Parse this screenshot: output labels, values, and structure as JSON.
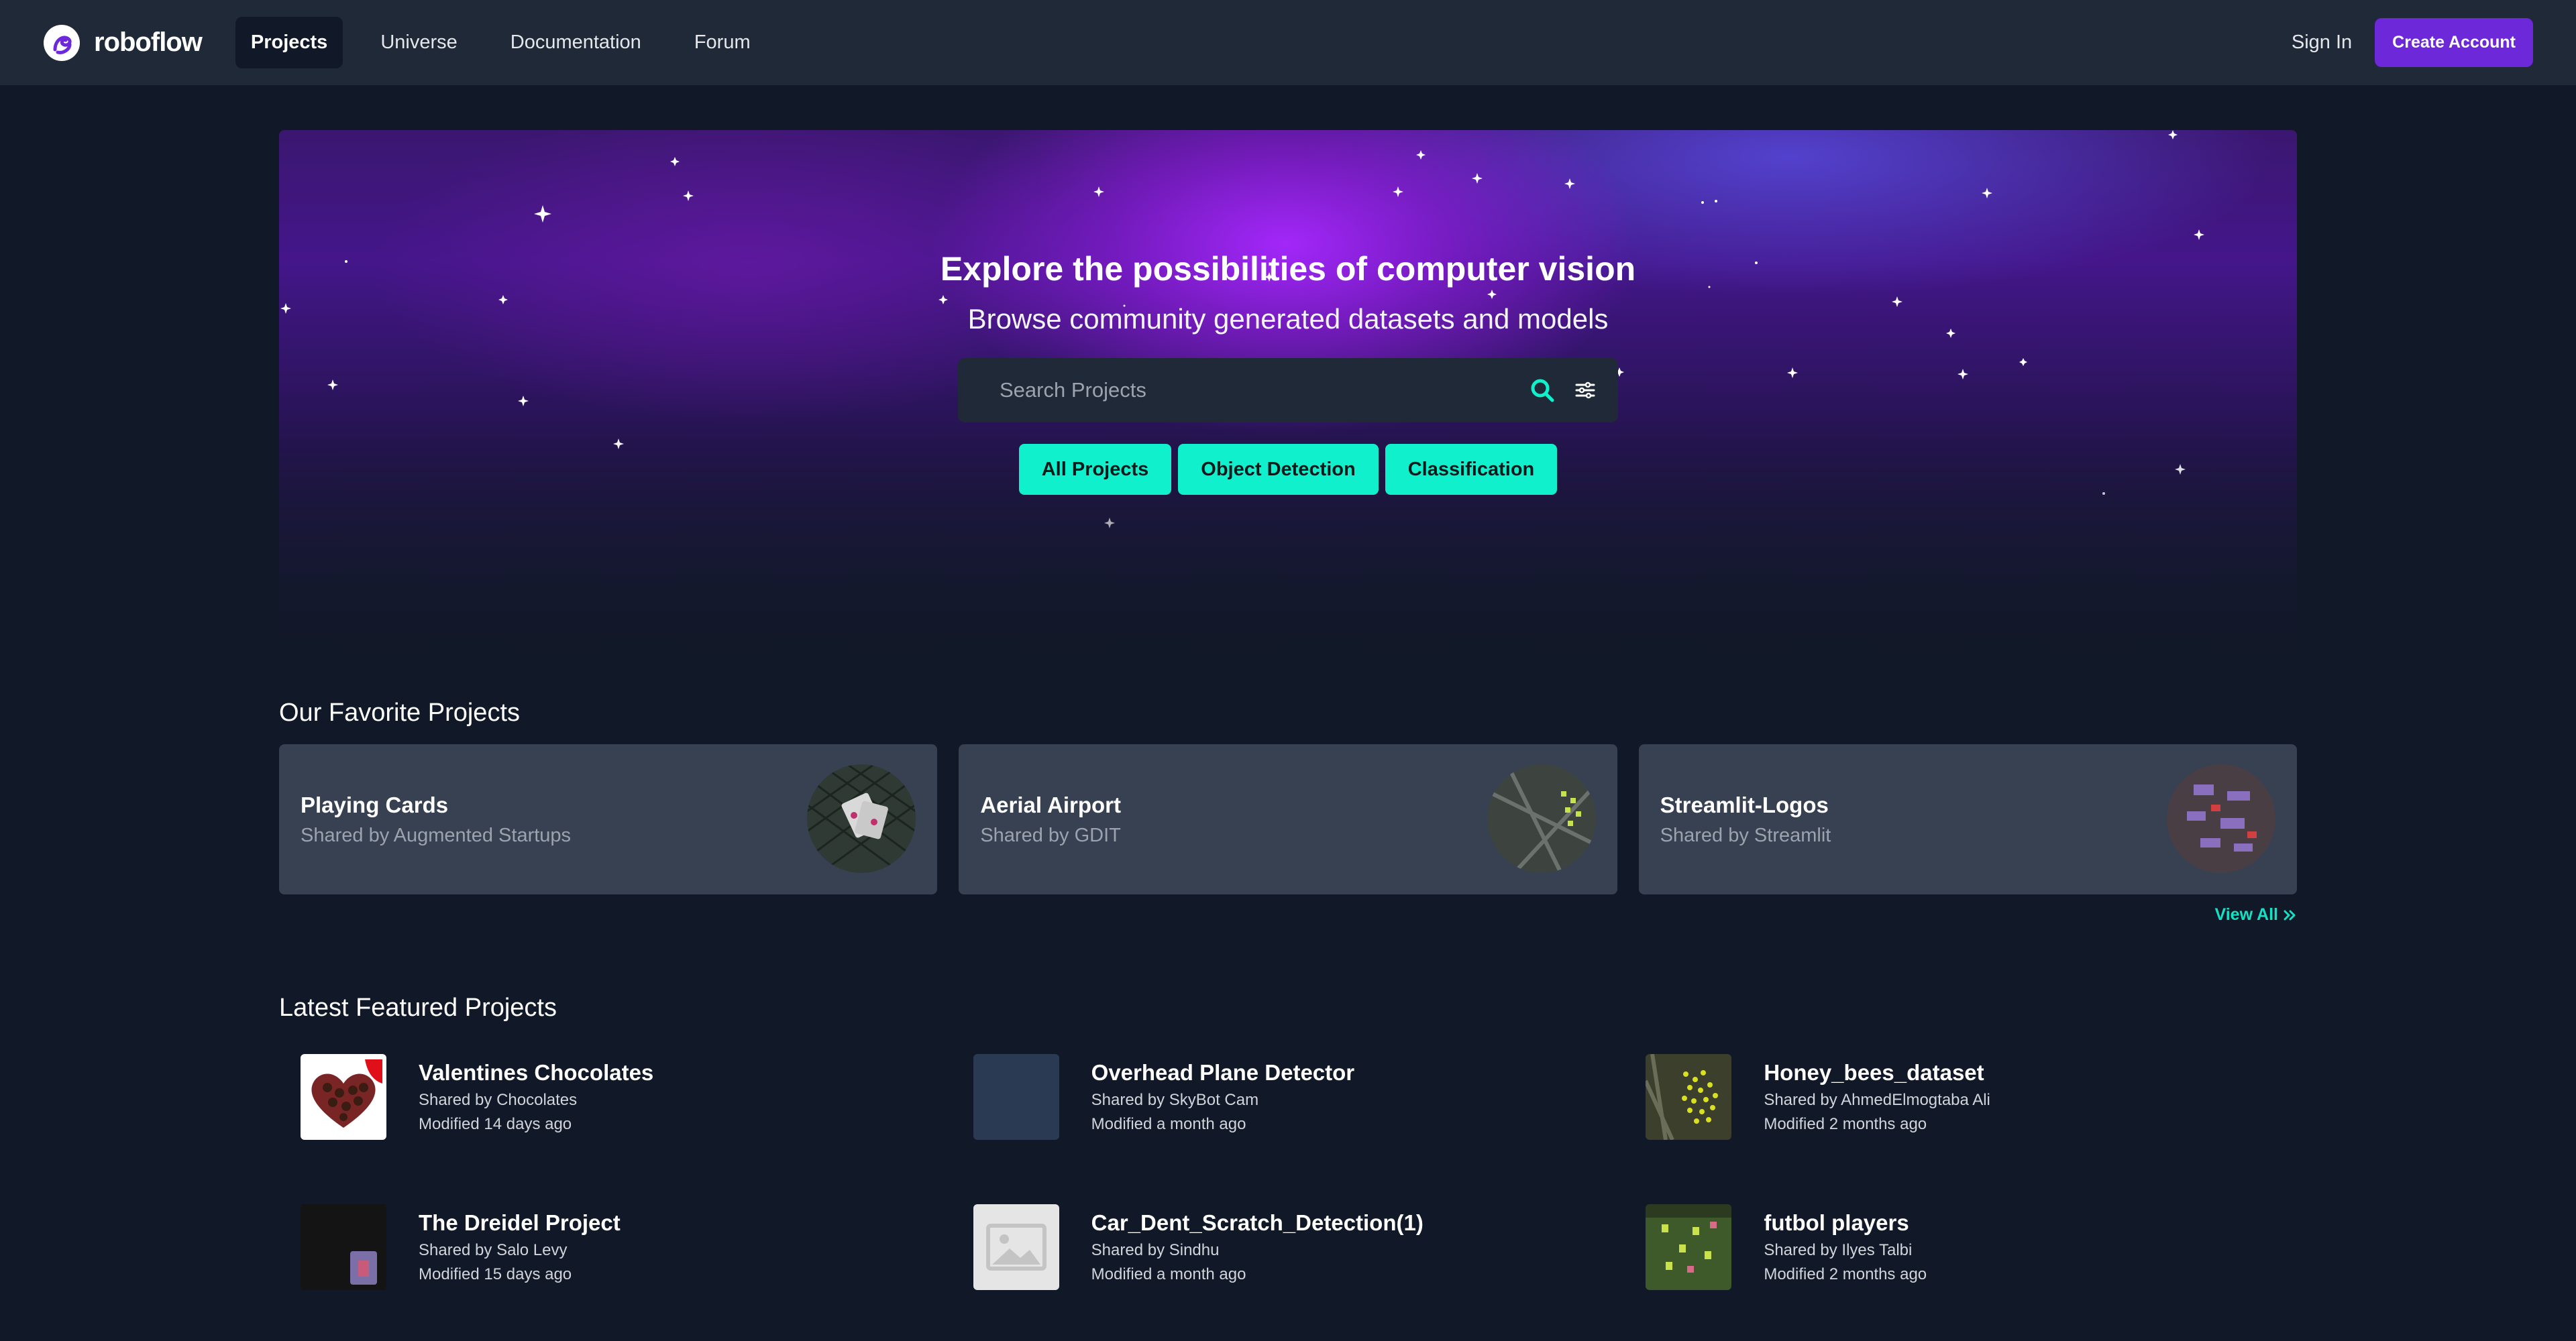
{
  "nav": {
    "logo_text": "roboflow",
    "items": [
      {
        "label": "Projects",
        "active": true
      },
      {
        "label": "Universe",
        "active": false
      },
      {
        "label": "Documentation",
        "active": false
      },
      {
        "label": "Forum",
        "active": false
      }
    ],
    "sign_in": "Sign In",
    "create_account": "Create Account"
  },
  "hero": {
    "title": "Explore the possibilities of computer vision",
    "subtitle": "Browse community generated datasets and models",
    "search_placeholder": "Search Projects",
    "chips": [
      "All Projects",
      "Object Detection",
      "Classification"
    ]
  },
  "favorites": {
    "title": "Our Favorite Projects",
    "cards": [
      {
        "name": "Playing Cards",
        "shared_by": "Shared by Augmented Startups",
        "thumb": "playing-cards-thumb"
      },
      {
        "name": "Aerial Airport",
        "shared_by": "Shared by GDIT",
        "thumb": "aerial-airport-thumb"
      },
      {
        "name": "Streamlit-Logos",
        "shared_by": "Shared by Streamlit",
        "thumb": "streamlit-logos-thumb"
      }
    ],
    "view_all": "View All"
  },
  "latest": {
    "title": "Latest Featured Projects",
    "items": [
      {
        "name": "Valentines Chocolates",
        "shared_by": "Shared by Chocolates",
        "modified": "Modified 14 days ago",
        "thumb": "chocolates-thumb"
      },
      {
        "name": "Overhead Plane Detector",
        "shared_by": "Shared by SkyBot Cam",
        "modified": "Modified a month ago",
        "thumb": "plane-thumb"
      },
      {
        "name": "Honey_bees_dataset",
        "shared_by": "Shared by AhmedElmogtaba Ali",
        "modified": "Modified 2 months ago",
        "thumb": "bees-thumb"
      },
      {
        "name": "The Dreidel Project",
        "shared_by": "Shared by Salo Levy",
        "modified": "Modified 15 days ago",
        "thumb": "dreidel-thumb"
      },
      {
        "name": "Car_Dent_Scratch_Detection(1)",
        "shared_by": "Shared by Sindhu",
        "modified": "Modified a month ago",
        "thumb": "placeholder-image-icon"
      },
      {
        "name": "futbol players",
        "shared_by": "Shared by Ilyes Talbi",
        "modified": "Modified 2 months ago",
        "thumb": "futbol-thumb"
      }
    ]
  },
  "colors": {
    "background": "#111827",
    "nav": "#1f2937",
    "accent_purple": "#6d28d9",
    "accent_teal": "#10f0cc",
    "card": "#374151"
  }
}
